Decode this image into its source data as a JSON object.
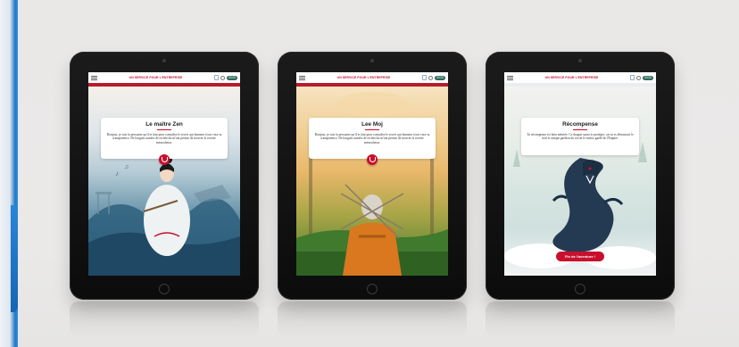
{
  "header": {
    "brand": "UN SERVICE POUR L'ENTREPRISE",
    "timer": "00:00"
  },
  "screens": [
    {
      "title": "Le maître Zen",
      "body": "Bonjour, je suis la personne qu'il te faut pour connaître le secret qui donnera à ton vase sa transparence. De longues années de recherche m'ont permis de trouver la recette miraculeuse."
    },
    {
      "title": "Lee Moj",
      "body": "Bonjour, je suis la personne qu'il te faut pour connaître le secret qui donnera à ton vase sa transparence. De longues années de recherche m'ont permis de trouver la recette miraculeuse."
    },
    {
      "title": "Récompense",
      "body": "Ta récompense est bien méritée. Ce dragon saura te protéger, car tu es désormais le seul et unique gardien du secret le mieux gardé de l'Empire.",
      "cta": "Fin de l'aventure !"
    }
  ],
  "colors": {
    "brand_red": "#c8102e",
    "timer_bg": "#2f6a5a"
  },
  "icons": [
    "menu-icon",
    "badge-icon",
    "clock-icon",
    "audio-icon"
  ]
}
